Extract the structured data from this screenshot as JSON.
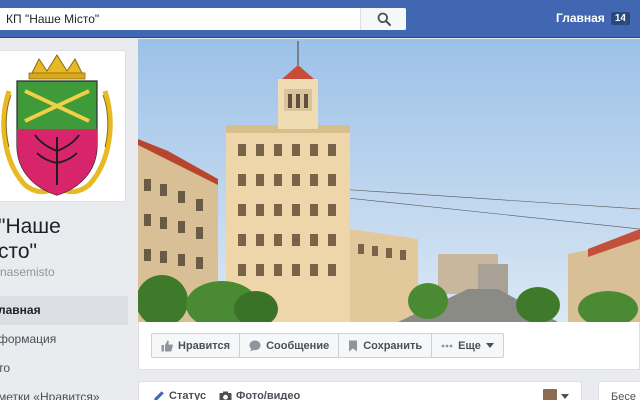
{
  "topbar": {
    "search_value": "КП \"Наше Місто\"",
    "nav_home_label": "Главная",
    "nav_home_count": "14",
    "brand_color": "#4267b2"
  },
  "sidebar": {
    "page_name": "\"Наше\nсто\"",
    "username": "nasemisto",
    "items": [
      {
        "label": "лавная",
        "active": true
      },
      {
        "label": "формация",
        "active": false
      },
      {
        "label": "то",
        "active": false
      },
      {
        "label": "метки «Нравится»",
        "active": false
      }
    ]
  },
  "actions": {
    "like": "Нравится",
    "message": "Сообщение",
    "save": "Сохранить",
    "more": "Еще"
  },
  "composer": {
    "status": "Статус",
    "photo": "Фото/видео"
  },
  "right_box": {
    "text": "Бесе"
  },
  "icons": [
    "search-icon",
    "thumbs-up-icon",
    "chat-bubble-icon",
    "bookmark-icon",
    "more-dots-icon",
    "pencil-icon",
    "camera-icon",
    "chevron-down-icon"
  ]
}
